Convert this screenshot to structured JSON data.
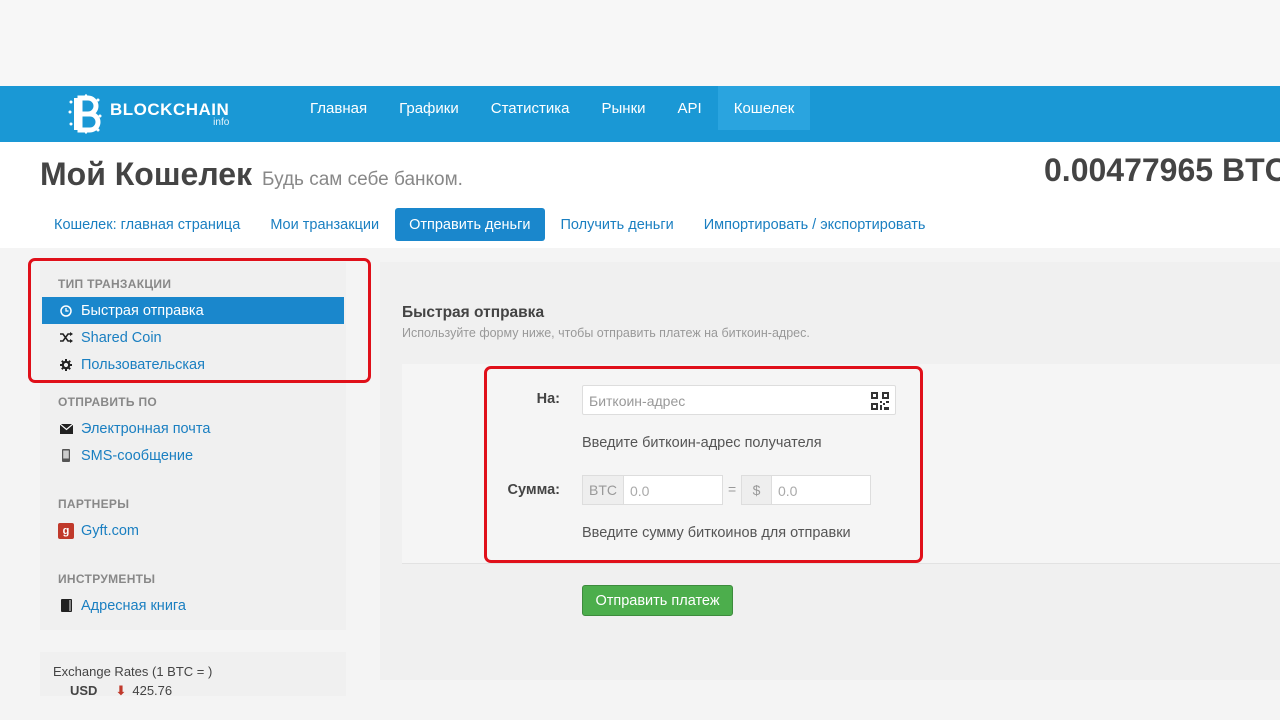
{
  "navbar": {
    "logo_title": "BLOCKCHAIN",
    "logo_sub": "info",
    "items": [
      {
        "label": "Главная"
      },
      {
        "label": "Графики"
      },
      {
        "label": "Статистика"
      },
      {
        "label": "Рынки"
      },
      {
        "label": "API"
      },
      {
        "label": "Кошелек",
        "active": true
      }
    ]
  },
  "header": {
    "title": "Мой Кошелек",
    "tagline": "Будь сам себе банком.",
    "balance": "0.00477965 BTC"
  },
  "tabs": [
    {
      "label": "Кошелек: главная страница"
    },
    {
      "label": "Мои транзакции"
    },
    {
      "label": "Отправить деньги",
      "active": true
    },
    {
      "label": "Получить деньги"
    },
    {
      "label": "Импортировать / экспортировать"
    }
  ],
  "sidebar": {
    "tx_type": {
      "heading": "ТИП ТРАНЗАКЦИИ",
      "items": [
        {
          "label": "Быстрая отправка",
          "icon": "clock-icon",
          "active": true
        },
        {
          "label": "Shared Coin",
          "icon": "shuffle-icon"
        },
        {
          "label": "Пользовательская",
          "icon": "gear-icon"
        }
      ]
    },
    "send_by": {
      "heading": "ОТПРАВИТЬ ПО",
      "items": [
        {
          "label": "Электронная почта",
          "icon": "envelope-icon"
        },
        {
          "label": "SMS-сообщение",
          "icon": "phone-icon"
        }
      ]
    },
    "partners": {
      "heading": "ПАРТНЕРЫ",
      "items": [
        {
          "label": "Gyft.com",
          "icon": "gyft-icon",
          "icon_glyph": "g"
        }
      ]
    },
    "tools": {
      "heading": "ИНСТРУМЕНТЫ",
      "items": [
        {
          "label": "Адресная книга",
          "icon": "book-icon"
        }
      ]
    }
  },
  "rates": {
    "title": "Exchange Rates (1 BTC = )",
    "currency": "USD",
    "value": "425.76"
  },
  "main": {
    "title": "Быстрая отправка",
    "subtitle": "Используйте форму ниже, чтобы отправить платеж на биткоин-адрес.",
    "to_label": "На:",
    "address_placeholder": "Биткоин-адрес",
    "address_help": "Введите биткоин-адрес получателя",
    "amount_label": "Сумма:",
    "btc_addon": "BTC",
    "btc_value": "0.0",
    "equals": "=",
    "usd_addon": "$",
    "usd_value": "0.0",
    "amount_help": "Введите сумму биткоинов для отправки",
    "send_button": "Отправить платеж"
  },
  "colors": {
    "navbar": "#1a98d5",
    "accent": "#1a87cc",
    "send_button": "#4cae4c",
    "highlight": "#e0101a"
  }
}
